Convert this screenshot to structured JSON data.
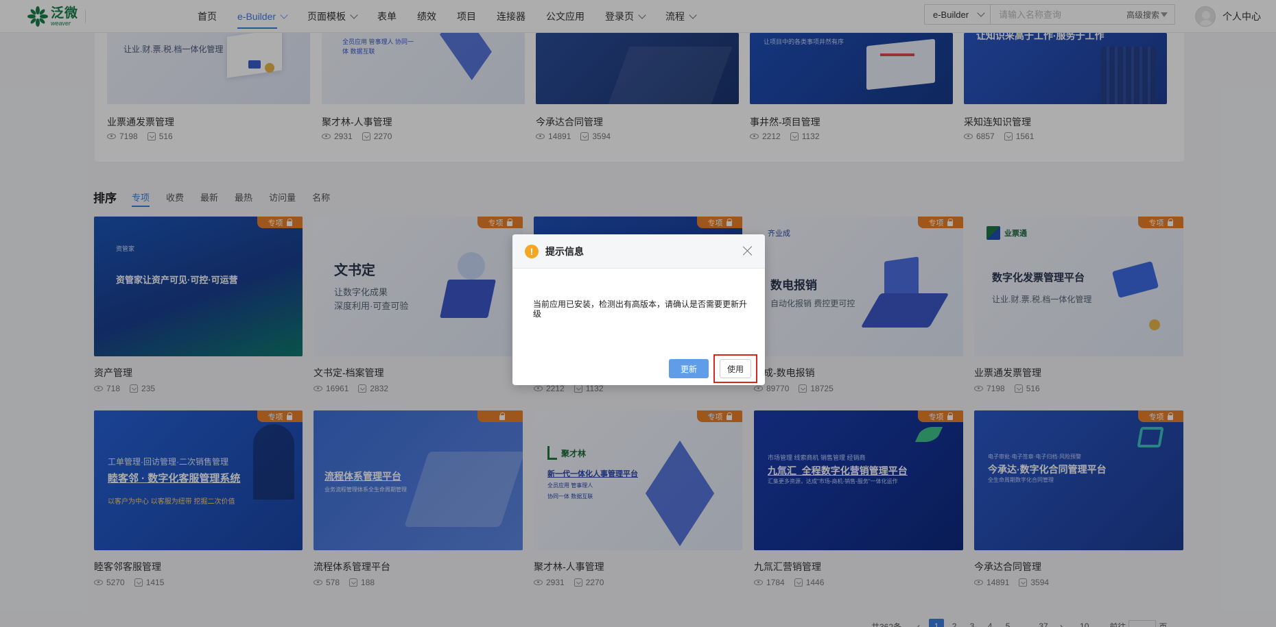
{
  "header": {
    "logo_cn": "泛微",
    "logo_en": "weaver",
    "nav": [
      {
        "label": "首页",
        "dropdown": false,
        "active": false
      },
      {
        "label": "e-Builder",
        "dropdown": true,
        "active": true
      },
      {
        "label": "页面模板",
        "dropdown": true,
        "active": false
      },
      {
        "label": "表单",
        "dropdown": false,
        "active": false
      },
      {
        "label": "绩效",
        "dropdown": false,
        "active": false
      },
      {
        "label": "项目",
        "dropdown": false,
        "active": false
      },
      {
        "label": "连接器",
        "dropdown": false,
        "active": false
      },
      {
        "label": "公文应用",
        "dropdown": false,
        "active": false
      },
      {
        "label": "登录页",
        "dropdown": true,
        "active": false
      },
      {
        "label": "流程",
        "dropdown": true,
        "active": false
      }
    ],
    "search_scope": "e-Builder",
    "search_placeholder": "请输入名称查询",
    "advanced_search": "高级搜索",
    "user": "个人中心"
  },
  "top_cards": [
    {
      "title": "业票通发票管理",
      "views": "7198",
      "installs": "516",
      "banner": "让业.财.票.税.档一体化管理"
    },
    {
      "title": "聚才林-人事管理",
      "views": "2931",
      "installs": "2270",
      "banner": "全员应用   管事理人   协同一体   数据互联"
    },
    {
      "title": "今承达合同管理",
      "views": "14891",
      "installs": "3594",
      "banner": ""
    },
    {
      "title": "事井然-项目管理",
      "views": "2212",
      "installs": "1132",
      "banner": "让项目中的各类事项井然有序"
    },
    {
      "title": "采知连知识管理",
      "views": "6857",
      "installs": "1561",
      "banner": "让知识来高于工作·服务于工作"
    }
  ],
  "sort": {
    "title": "排序",
    "tabs": [
      "专项",
      "收费",
      "最新",
      "最热",
      "访问量",
      "名称"
    ],
    "active": 0
  },
  "tag_label": "专项",
  "cards_row1": [
    {
      "title": "资产管理",
      "views": "718",
      "installs": "235",
      "brand": "资管家",
      "headline": "资管家让资产可见·可控·可运营"
    },
    {
      "title": "文书定-档案管理",
      "views": "16961",
      "installs": "2832",
      "brand": "",
      "headline": "文书定",
      "sub1": "让数字化成果",
      "sub2": "深度利用·可查可验"
    },
    {
      "title": "",
      "views": "2212",
      "installs": "1132",
      "brand": "",
      "headline": ""
    },
    {
      "title": "业成-数电报销",
      "views": "89770",
      "installs": "18725",
      "brand": "齐业成",
      "headline": "数电报销",
      "sub1": "自动化报销 费控更可控"
    },
    {
      "title": "业票通发票管理",
      "views": "7198",
      "installs": "516",
      "brand": "业票通",
      "headline": "数字化发票管理平台",
      "sub1": "让业.财.票.税.档一体化管理"
    }
  ],
  "cards_row2": [
    {
      "title": "睦客邻客服管理",
      "views": "5270",
      "installs": "1415",
      "sub1": "工单管理·回访管理·二次销售管理",
      "headline": "睦客邻 · 数字化客服管理系统",
      "sub2": "以客户为中心   以客服为纽带   挖掘二次价值"
    },
    {
      "title": "流程体系管理平台",
      "views": "578",
      "installs": "188",
      "headline": "流程体系管理平台",
      "sub1": "业务流程管理体系全生命周期管理"
    },
    {
      "title": "聚才林-人事管理",
      "views": "2931",
      "installs": "2270",
      "brand": "聚才林",
      "headline": "新一代一体化人事管理平台",
      "sub1": "全员应用   管事理人",
      "sub2": "协同一体   数据互联"
    },
    {
      "title": "九氚汇营销管理",
      "views": "1784",
      "installs": "1446",
      "sub1": "市场管理 线索商机 销售管理 经销商",
      "headline": "九氚汇_全程数字化营销管理平台",
      "sub2": "汇集更多资源，达成\"市场-商机-销售-服务\"一体化运作"
    },
    {
      "title": "今承达合同管理",
      "views": "14891",
      "installs": "3594",
      "sub1": "电子审批·电子签章·电子归档·风险预警",
      "headline": "今承达·数字化合同管理平台",
      "sub2": "全生命周期数字化合同管理"
    }
  ],
  "pagination": {
    "total": "共362条",
    "pages": [
      "1",
      "2",
      "3",
      "4",
      "5",
      "...",
      "37"
    ],
    "page_size": "10",
    "goto": "前往",
    "unit": "页"
  },
  "dialog": {
    "title": "提示信息",
    "message": "当前应用已安装，检测出有高版本，请确认是否需要更新升级",
    "update_label": "更新",
    "use_label": "使用"
  },
  "colors": {
    "accent": "#3d7ce0",
    "tag": "#e8802a",
    "warning": "#f5a623",
    "highlight": "#d9251e"
  }
}
